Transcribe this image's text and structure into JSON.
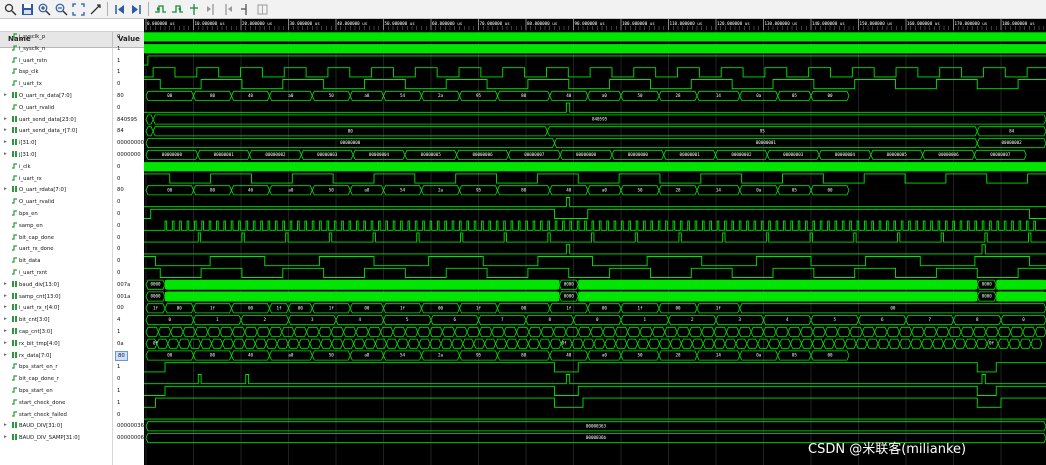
{
  "toolbar": {
    "icons": [
      "magnifier-icon",
      "save-icon",
      "zoom-in-icon",
      "zoom-out-icon",
      "zoom-fit-icon",
      "cursor-icon",
      "go-to-start-icon",
      "go-to-end-icon",
      "prev-transition-icon",
      "next-transition-icon",
      "add-marker-icon",
      "prev-marker-icon",
      "next-marker-icon",
      "swap-cursor-icon",
      "snap-icon"
    ]
  },
  "header": {
    "name": "Name",
    "value": "Value"
  },
  "signals": [
    {
      "name": "i_sysclk_p",
      "value": "0",
      "kind": "bit",
      "expand": false
    },
    {
      "name": "i_sysclk_n",
      "value": "1",
      "kind": "bit",
      "expand": false
    },
    {
      "name": "i_uart_rstn",
      "value": "1",
      "kind": "bit",
      "expand": false
    },
    {
      "name": "bsp_clk",
      "value": "1",
      "kind": "bit",
      "expand": false
    },
    {
      "name": "i_uart_tx",
      "value": "0",
      "kind": "bit",
      "expand": false
    },
    {
      "name": "O_uart_rx_data[7:0]",
      "value": "80",
      "kind": "bus",
      "expand": true
    },
    {
      "name": "O_uart_rvalid",
      "value": "0",
      "kind": "bit",
      "expand": false
    },
    {
      "name": "uart_send_data[23:0]",
      "value": "840595",
      "kind": "bus",
      "expand": true
    },
    {
      "name": "uart_send_data_r[7:0]",
      "value": "84",
      "kind": "bus",
      "expand": true
    },
    {
      "name": "i[31:0]",
      "value": "00000000",
      "kind": "bus",
      "expand": true
    },
    {
      "name": "j[31:0]",
      "value": "0000000",
      "kind": "bus",
      "expand": true
    },
    {
      "name": "i_clk",
      "value": "0",
      "kind": "bit",
      "expand": false
    },
    {
      "name": "i_uart_rx",
      "value": "0",
      "kind": "bit",
      "expand": false
    },
    {
      "name": "O_uart_rdata[7:0]",
      "value": "80",
      "kind": "bus",
      "expand": true
    },
    {
      "name": "O_uart_rvalid",
      "value": "0",
      "kind": "bit",
      "expand": false
    },
    {
      "name": "bps_en",
      "value": "0",
      "kind": "bit",
      "expand": false
    },
    {
      "name": "samp_en",
      "value": "0",
      "kind": "bit",
      "expand": false
    },
    {
      "name": "bit_cap_done",
      "value": "0",
      "kind": "bit",
      "expand": false
    },
    {
      "name": "uart_rx_done",
      "value": "0",
      "kind": "bit",
      "expand": false
    },
    {
      "name": "bit_data",
      "value": "0",
      "kind": "bit",
      "expand": false
    },
    {
      "name": "i_uart_rxnt",
      "value": "0",
      "kind": "bit",
      "expand": false
    },
    {
      "name": "baud_div[13:0]",
      "value": "007a",
      "kind": "bus",
      "expand": true
    },
    {
      "name": "samp_cnt[13:0]",
      "value": "001a",
      "kind": "bus",
      "expand": true
    },
    {
      "name": "i_uart_rx_r[4:0]",
      "value": "00",
      "kind": "bus",
      "expand": true
    },
    {
      "name": "bit_cnt[3:0]",
      "value": "4",
      "kind": "bus",
      "expand": true
    },
    {
      "name": "cap_cnt[3:0]",
      "value": "1",
      "kind": "bus",
      "expand": true
    },
    {
      "name": "rx_bit_tmp[4:0]",
      "value": "0a",
      "kind": "bus",
      "expand": true
    },
    {
      "name": "rx_data[7:0]",
      "value": "80",
      "kind": "bus",
      "expand": true,
      "selected": true
    },
    {
      "name": "bps_start_en_r",
      "value": "1",
      "kind": "bit",
      "expand": false
    },
    {
      "name": "bit_cap_done_r",
      "value": "0",
      "kind": "bit",
      "expand": false
    },
    {
      "name": "bps_start_en",
      "value": "1",
      "kind": "bit",
      "expand": false
    },
    {
      "name": "start_check_done",
      "value": "1",
      "kind": "bit",
      "expand": false
    },
    {
      "name": "start_check_failed",
      "value": "0",
      "kind": "bit",
      "expand": false
    },
    {
      "name": "BAUD_DIV[31:0]",
      "value": "00000036",
      "kind": "bus",
      "expand": true
    },
    {
      "name": "BAUD_DIV_SAMP[31:0]",
      "value": "00000006",
      "kind": "bus",
      "expand": true
    }
  ],
  "timeline": {
    "labels": [
      "0.000000 us",
      "10.000000 us",
      "20.000000 us",
      "30.000000 us",
      "40.000000 us",
      "50.000000 us",
      "60.000000 us",
      "70.000000 us",
      "80.000000 us",
      "90.000000 us",
      "100.000000 us",
      "110.000000 us",
      "120.000000 us",
      "130.000000 us",
      "140.000000 us",
      "150.000000 us",
      "160.000000 us",
      "170.000000 us",
      "180.000000 us"
    ]
  },
  "byte_seq": [
    "00",
    "80",
    "40",
    "a0",
    "50",
    "a8",
    "54",
    "2a",
    "95",
    "80",
    "40",
    "a0",
    "50",
    "28",
    "14",
    "0a",
    "05",
    "00"
  ],
  "bus_text": {
    "uart_send_data": [
      "840595"
    ],
    "uart_send_data_r": [
      "00",
      "95",
      "84"
    ],
    "i": [
      "00000000",
      "00000001",
      "00000002"
    ],
    "j": [
      "00000000",
      "00000001",
      "00000002",
      "00000003",
      "00000004",
      "00000005",
      "00000006",
      "00000007",
      "00000000",
      "00000000",
      "00000001",
      "00000002",
      "00000003",
      "00000004",
      "00000005",
      "00000006",
      "00000007"
    ],
    "baud_div": [
      "0000",
      "0000",
      "0000"
    ],
    "samp_cnt": [
      "0000",
      "0000",
      "0000"
    ],
    "uart_rx_r": [
      "1f",
      "00",
      "1f",
      "00",
      "1f",
      "00",
      "1f",
      "00",
      "1f",
      "00",
      "1f",
      "00",
      "1f",
      "00",
      "1f",
      "00",
      "1f",
      "00"
    ],
    "bit_cnt": [
      "0",
      "1",
      "2",
      "3",
      "4",
      "5",
      "6",
      "7",
      "8",
      "0",
      "1",
      "2",
      "3",
      "4",
      "5",
      "6",
      "7",
      "8",
      "0"
    ],
    "rx_bit_tmp": [
      "0f",
      "0f",
      "0f"
    ],
    "baud_const": [
      "00000363"
    ],
    "baud_samp_const": [
      "0000036b"
    ]
  },
  "watermark": "CSDN @米联客(milianke)",
  "colors": {
    "waveform": "#00e600",
    "bg": "#000000",
    "grid": "#3a3a3a",
    "text": "#ffffff"
  }
}
